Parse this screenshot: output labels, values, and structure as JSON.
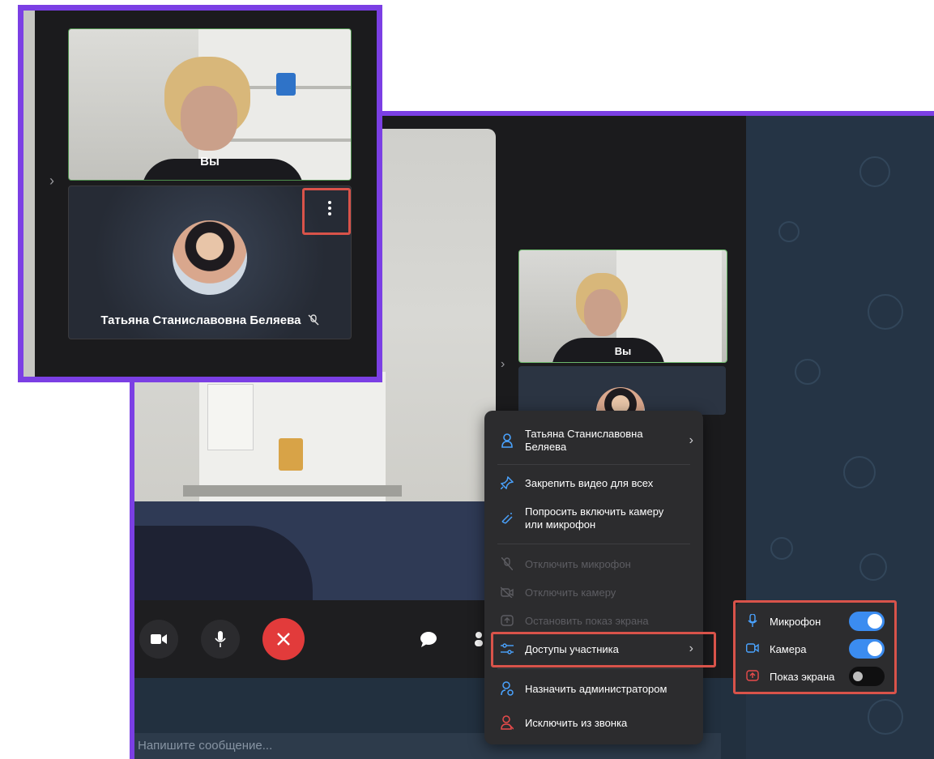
{
  "participants": {
    "self_label": "Вы",
    "other_name": "Татьяна Станиславовна Беляева"
  },
  "context_menu": {
    "profile_name": "Татьяна Станиславовна Беляева",
    "items": [
      {
        "label": "Закрепить видео для всех",
        "icon": "pin-icon",
        "enabled": true
      },
      {
        "label": "Попросить включить камеру или микрофон",
        "icon": "request-icon",
        "enabled": true
      },
      {
        "label": "Отключить микрофон",
        "icon": "mic-off-icon",
        "enabled": false
      },
      {
        "label": "Отключить камеру",
        "icon": "camera-off-icon",
        "enabled": false
      },
      {
        "label": "Остановить показ экрана",
        "icon": "screen-share-stop-icon",
        "enabled": false
      },
      {
        "label": "Доступы участника",
        "icon": "sliders-icon",
        "enabled": true
      },
      {
        "label": "Назначить администратором",
        "icon": "admin-icon",
        "enabled": true
      },
      {
        "label": "Исключить из звонка",
        "icon": "remove-user-icon",
        "enabled": true
      }
    ]
  },
  "permissions": [
    {
      "label": "Микрофон",
      "icon": "mic-icon",
      "on": true
    },
    {
      "label": "Камера",
      "icon": "camera-icon",
      "on": true
    },
    {
      "label": "Показ экрана",
      "icon": "screen-share-icon",
      "on": false
    }
  ],
  "chat": {
    "placeholder": "Напишите сообщение..."
  },
  "colors": {
    "accent": "#4aa3ff",
    "highlight": "#d9534a",
    "frame": "#7b3fe4",
    "end_call": "#e23b3b",
    "toggle_on": "#3b8cf0"
  }
}
